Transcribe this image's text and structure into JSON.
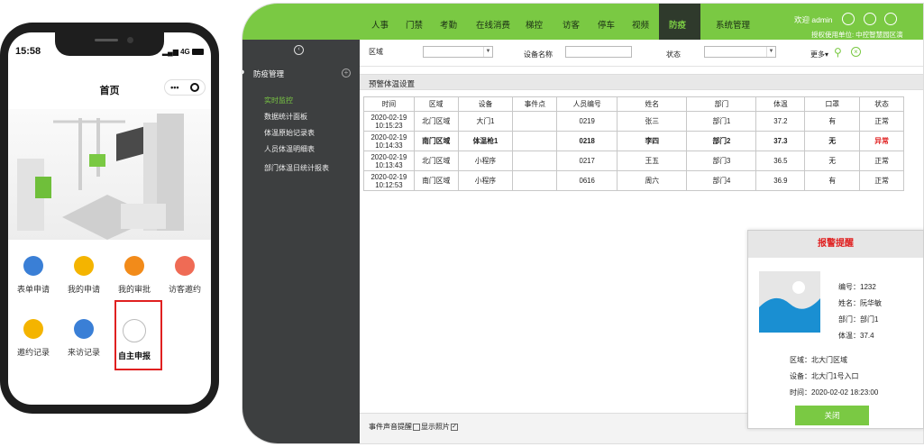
{
  "phone": {
    "time": "15:58",
    "signal": "4G",
    "title": "首页",
    "capsule_more": "•••",
    "apps": [
      {
        "label": "表单申请",
        "icon": "form-icon",
        "color": "#3a7fd6"
      },
      {
        "label": "我的申请",
        "icon": "apply-doc-icon",
        "color": "#f4b400"
      },
      {
        "label": "我的审批",
        "icon": "approve-stamp-icon",
        "color": "#f28b1a"
      },
      {
        "label": "访客邀约",
        "icon": "visitor-invite-icon",
        "color": "#ef6b55"
      },
      {
        "label": "邀约记录",
        "icon": "invite-record-icon",
        "color": "#f4b400"
      },
      {
        "label": "来访记录",
        "icon": "visit-record-icon",
        "color": "#3a7fd6"
      },
      {
        "label": "自主申报",
        "icon": "self-report-icon",
        "color": "#ffffff"
      }
    ]
  },
  "app": {
    "nav": [
      "人事",
      "门禁",
      "考勤",
      "在线消费",
      "梯控",
      "访客",
      "停车",
      "视频",
      "防疫",
      "系统管理"
    ],
    "nav_active": "防疫",
    "welcome": "欢迎 admin",
    "auth_unit": "授权使用单位: 中控智慧园区演",
    "sidebar": {
      "group": "防疫管理",
      "items": [
        "实时监控",
        "数据统计面板",
        "体温原始记录表",
        "人员体温明细表",
        "部门体温日统计报表"
      ]
    },
    "filter": {
      "area_label": "区域",
      "device_label": "设备名称",
      "status_label": "状态",
      "more_label": "更多▾"
    },
    "section_title": "预警体温设置",
    "table": {
      "headers": [
        "时间",
        "区域",
        "设备",
        "事件点",
        "人员编号",
        "姓名",
        "部门",
        "体温",
        "口罩",
        "状态"
      ],
      "rows": [
        {
          "date": "2020-02-19",
          "time": "10:15:23",
          "area": "北门区域",
          "device": "大门1",
          "event": "",
          "id": "0219",
          "name": "张三",
          "dept": "部门1",
          "temp": "37.2",
          "mask": "有",
          "status": "正常"
        },
        {
          "date": "2020-02-19",
          "time": "10:14:33",
          "area": "南门区域",
          "device": "体温枪1",
          "event": "",
          "id": "0218",
          "name": "李四",
          "dept": "部门2",
          "temp": "37.3",
          "mask": "无",
          "status": "异常"
        },
        {
          "date": "2020-02-19",
          "time": "10:13:43",
          "area": "北门区域",
          "device": "小程序",
          "event": "",
          "id": "0217",
          "name": "王五",
          "dept": "部门3",
          "temp": "36.5",
          "mask": "无",
          "status": "正常"
        },
        {
          "date": "2020-02-19",
          "time": "10:12:53",
          "area": "南门区域",
          "device": "小程序",
          "event": "",
          "id": "0616",
          "name": "周六",
          "dept": "部门4",
          "temp": "36.9",
          "mask": "有",
          "status": "正常"
        }
      ]
    },
    "footer": {
      "sound_label": "事件声音提醒",
      "photo_label": "显示照片"
    },
    "alarm": {
      "title": "报警提醒",
      "id_line": "编号：1232",
      "name_line": "姓名：阮华敏",
      "dept_line": "部门：部门1",
      "temp_line": "体温：37.4",
      "area_line": "区域：北大门区域",
      "device_line": "设备：北大门1号入口",
      "time_line": "时间：2020-02-02 18:23:00",
      "close_label": "关闭"
    }
  }
}
